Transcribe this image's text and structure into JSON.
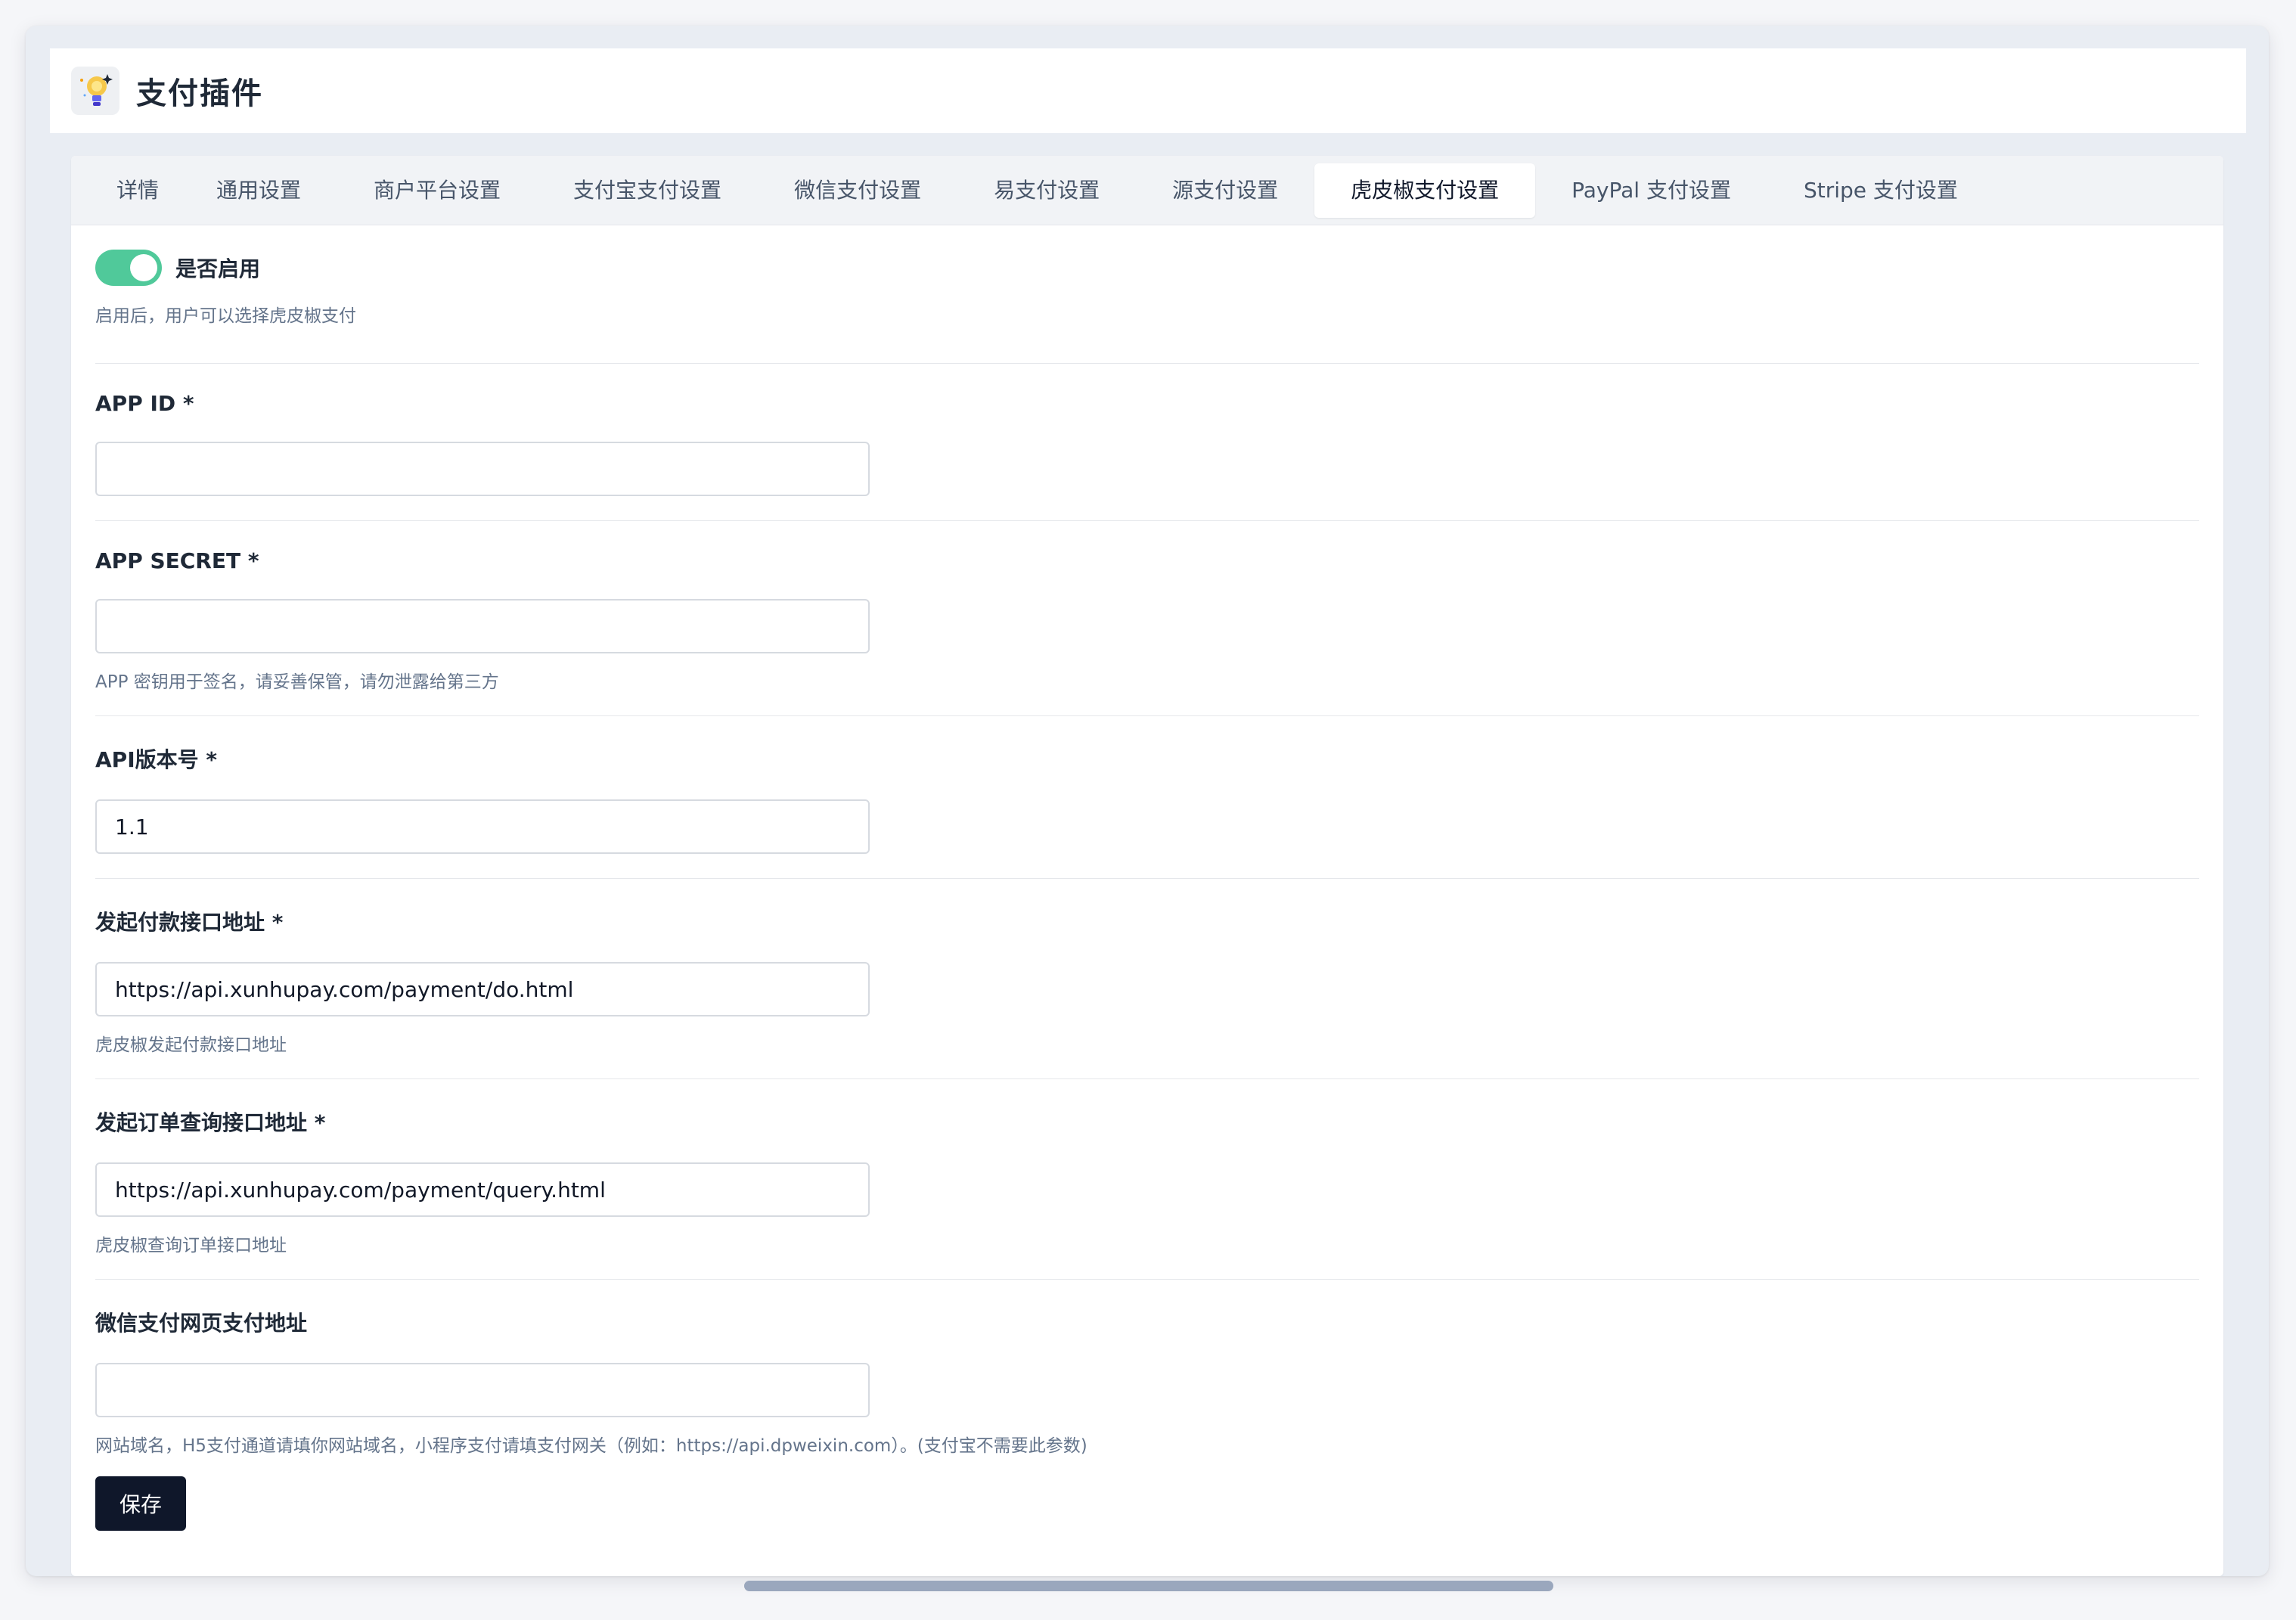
{
  "header": {
    "title": "支付插件",
    "logo_icon": "plugin-bulb-icon"
  },
  "tabs": [
    {
      "label": "详情",
      "active": false
    },
    {
      "label": "通用设置",
      "active": false
    },
    {
      "label": "商户平台设置",
      "active": false
    },
    {
      "label": "支付宝支付设置",
      "active": false
    },
    {
      "label": "微信支付设置",
      "active": false
    },
    {
      "label": "易支付设置",
      "active": false
    },
    {
      "label": "源支付设置",
      "active": false
    },
    {
      "label": "虎皮椒支付设置",
      "active": true
    },
    {
      "label": "PayPal 支付设置",
      "active": false
    },
    {
      "label": "Stripe 支付设置",
      "active": false
    }
  ],
  "enable": {
    "label": "是否启用",
    "on": true,
    "hint": "启用后，用户可以选择虎皮椒支付"
  },
  "fields": {
    "app_id": {
      "label": "APP ID *",
      "value": ""
    },
    "app_secret": {
      "label": "APP SECRET *",
      "value": "",
      "hint": "APP 密钥用于签名，请妥善保管，请勿泄露给第三方"
    },
    "api_version": {
      "label": "API版本号 *",
      "value": "1.1"
    },
    "pay_url": {
      "label": "发起付款接口地址 *",
      "value": "https://api.xunhupay.com/payment/do.html",
      "hint": "虎皮椒发起付款接口地址"
    },
    "query_url": {
      "label": "发起订单查询接口地址 *",
      "value": "https://api.xunhupay.com/payment/query.html",
      "hint": "虎皮椒查询订单接口地址"
    },
    "wechat_url": {
      "label": "微信支付网页支付地址",
      "value": "",
      "hint": "网站域名，H5支付通道请填你网站域名，小程序支付请填支付网关（例如：https://api.dpweixin.com）。(支付宝不需要此参数)"
    }
  },
  "save_label": "保存",
  "colors": {
    "accent": "#50c99a",
    "primary_button": "#0f172a"
  }
}
